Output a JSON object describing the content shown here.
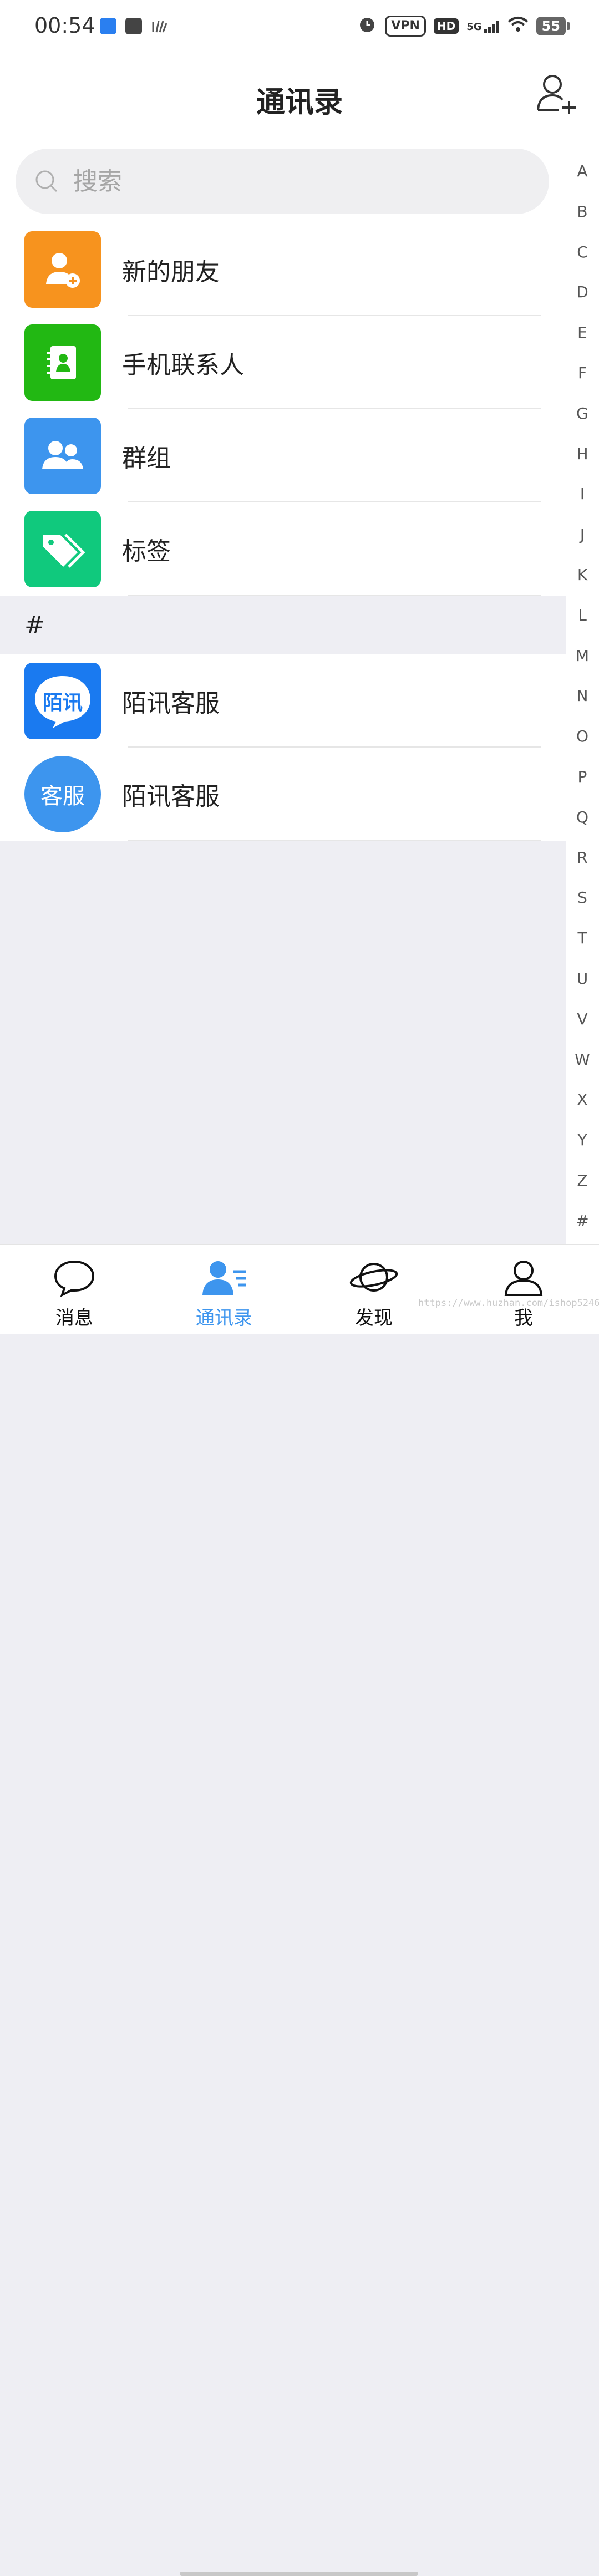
{
  "status_bar": {
    "time": "00:54",
    "vpn": "VPN",
    "hd": "HD",
    "network": "5G",
    "battery": "55"
  },
  "header": {
    "title": "通讯录"
  },
  "search": {
    "placeholder": "搜索"
  },
  "top_items": [
    {
      "label": "新的朋友",
      "icon": "new-friend-icon"
    },
    {
      "label": "手机联系人",
      "icon": "phone-contacts-icon"
    },
    {
      "label": "群组",
      "icon": "group-icon"
    },
    {
      "label": "标签",
      "icon": "tag-icon"
    }
  ],
  "sections": [
    {
      "header": "#",
      "contacts": [
        {
          "name": "陌讯客服",
          "avatar_text": "陌讯"
        },
        {
          "name": "陌讯客服",
          "avatar_text": "客服"
        }
      ]
    }
  ],
  "index_letters": [
    "A",
    "B",
    "C",
    "D",
    "E",
    "F",
    "G",
    "H",
    "I",
    "J",
    "K",
    "L",
    "M",
    "N",
    "O",
    "P",
    "Q",
    "R",
    "S",
    "T",
    "U",
    "V",
    "W",
    "X",
    "Y",
    "Z",
    "#"
  ],
  "tabs": [
    {
      "label": "消息",
      "icon": "chat-bubble-icon"
    },
    {
      "label": "通讯录",
      "icon": "contacts-icon",
      "active": true
    },
    {
      "label": "发现",
      "icon": "planet-icon"
    },
    {
      "label": "我",
      "icon": "person-icon"
    }
  ],
  "watermark": "https://www.huzhan.com/ishop52469",
  "colors": {
    "accent": "#3d95ee",
    "orange": "#f7931e",
    "green": "#22b813",
    "teal": "#10c97d"
  }
}
